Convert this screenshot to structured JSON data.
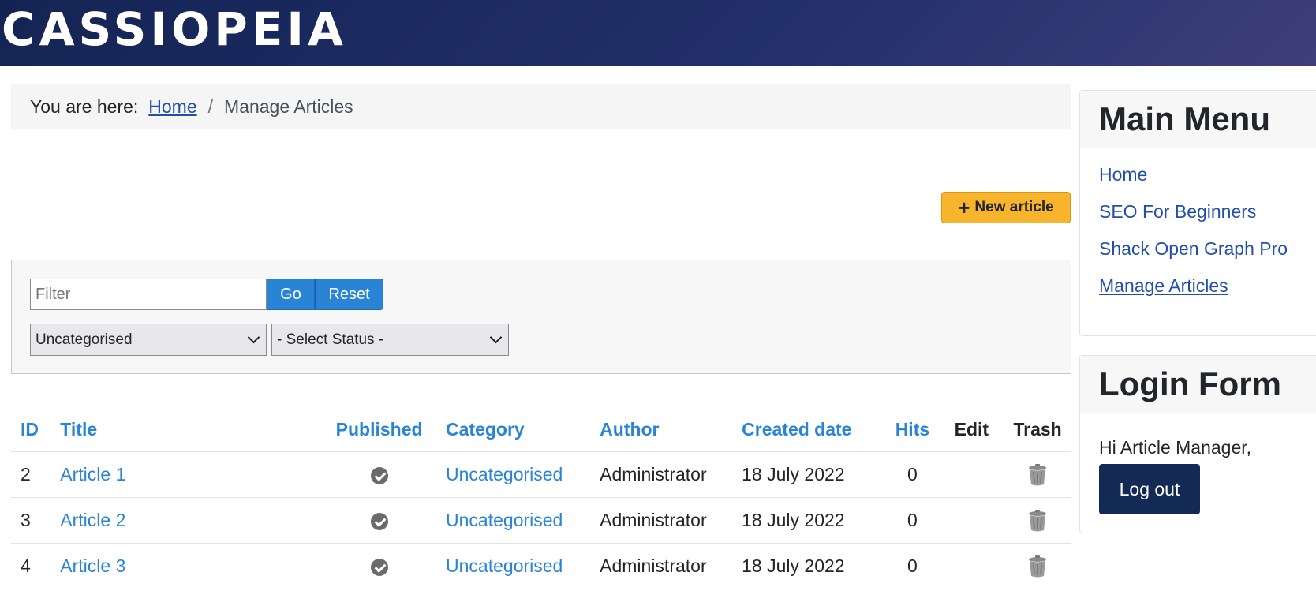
{
  "site": {
    "brand": "CASSIOPEIA"
  },
  "breadcrumb": {
    "prefix": "You are here:",
    "home": "Home",
    "separator": "/",
    "current": "Manage Articles"
  },
  "toolbar": {
    "new_article_label": "New article"
  },
  "filter": {
    "placeholder": "Filter",
    "go_label": "Go",
    "reset_label": "Reset",
    "category_selected": "Uncategorised",
    "status_selected": "- Select Status -"
  },
  "table": {
    "headers": {
      "id": "ID",
      "title": "Title",
      "published": "Published",
      "category": "Category",
      "author": "Author",
      "created": "Created date",
      "hits": "Hits",
      "edit": "Edit",
      "trash": "Trash"
    },
    "rows": [
      {
        "id": "2",
        "title": "Article 1",
        "published": true,
        "category": "Uncategorised",
        "author": "Administrator",
        "created": "18 July 2022",
        "hits": "0"
      },
      {
        "id": "3",
        "title": "Article 2",
        "published": true,
        "category": "Uncategorised",
        "author": "Administrator",
        "created": "18 July 2022",
        "hits": "0"
      },
      {
        "id": "4",
        "title": "Article 3",
        "published": true,
        "category": "Uncategorised",
        "author": "Administrator",
        "created": "18 July 2022",
        "hits": "0"
      }
    ]
  },
  "main_menu": {
    "title": "Main Menu",
    "items": [
      {
        "label": "Home",
        "active": false
      },
      {
        "label": "SEO For Beginners",
        "active": false
      },
      {
        "label": "Shack Open Graph Pro",
        "active": false
      },
      {
        "label": "Manage Articles",
        "active": true
      }
    ]
  },
  "login_form": {
    "title": "Login Form",
    "greeting": "Hi Article Manager,",
    "logout_label": "Log out"
  },
  "colors": {
    "header_start": "#132454",
    "header_end": "#3e3f7a",
    "accent": "#2a84d6",
    "new_button": "#f8b42d",
    "logout_button": "#132a54"
  },
  "icons": {
    "published": "check-circle-icon",
    "trash": "trash-icon",
    "new": "plus-icon",
    "dropdown": "chevron-down-icon"
  }
}
